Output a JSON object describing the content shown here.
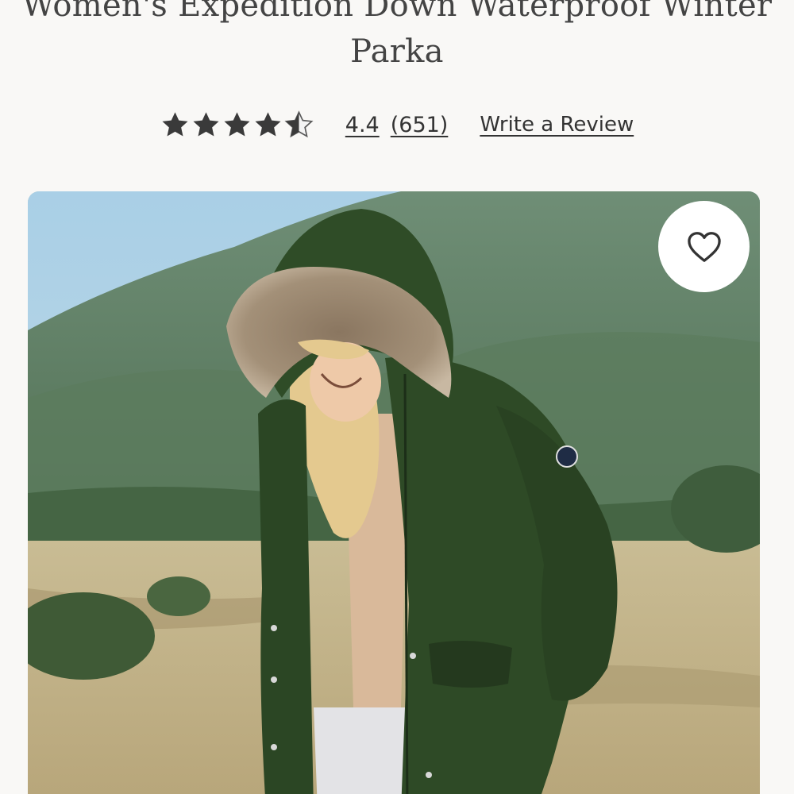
{
  "product": {
    "title": "Women's Expedition Down Waterproof Winter Parka"
  },
  "rating": {
    "stars": 4.4,
    "value_text": "4.4",
    "count_text": "(651)",
    "write_review_label": "Write a Review"
  },
  "favorite": {
    "icon": "heart-icon"
  },
  "colors": {
    "background": "#f9f8f6",
    "star_fill": "#3a3a3a",
    "star_empty": "#c9c9c9",
    "parka_green": "#2e4a26"
  }
}
